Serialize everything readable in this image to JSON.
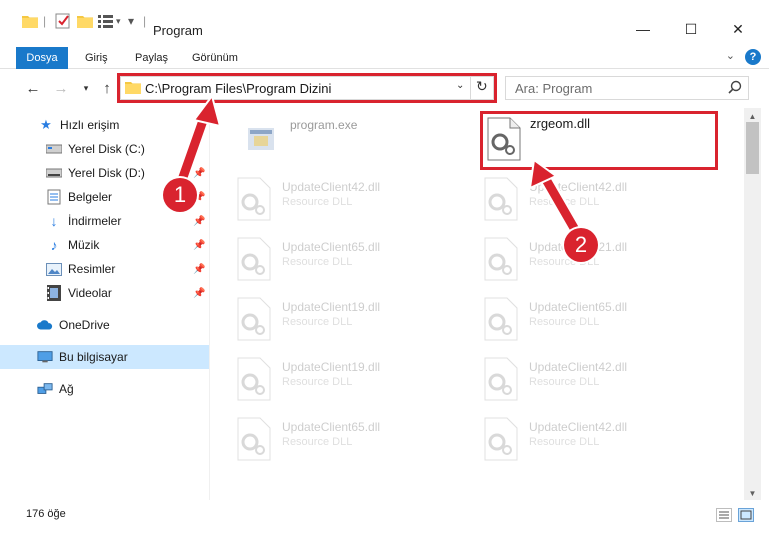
{
  "window": {
    "title": "Program",
    "minimize": "—",
    "maximize": "☐",
    "close": "✕"
  },
  "ribbon": {
    "file_tab": "Dosya",
    "tabs": [
      "Giriş",
      "Paylaş",
      "Görünüm"
    ],
    "help": "?",
    "collapse": "⌄"
  },
  "nav": {
    "address": "C:\\Program Files\\Program Dizini",
    "search_placeholder": "Ara: Program"
  },
  "sidebar": {
    "items": [
      {
        "label": "Hızlı erişim",
        "icon": "star-icon"
      },
      {
        "label": "Yerel Disk (C:)",
        "icon": "disk-icon"
      },
      {
        "label": "Yerel Disk (D:)",
        "icon": "disk-icon"
      },
      {
        "label": "Belgeler",
        "icon": "documents-icon"
      },
      {
        "label": "İndirmeler",
        "icon": "download-icon"
      },
      {
        "label": "Müzik",
        "icon": "music-icon"
      },
      {
        "label": "Resimler",
        "icon": "pictures-icon"
      },
      {
        "label": "Videolar",
        "icon": "video-icon"
      },
      {
        "label": "OneDrive",
        "icon": "cloud-icon"
      },
      {
        "label": "Bu bilgisayar",
        "icon": "computer-icon"
      },
      {
        "label": "Ağ",
        "icon": "network-icon"
      }
    ]
  },
  "files": {
    "left": [
      {
        "name": "program.exe",
        "type": ""
      },
      {
        "name": "UpdateClient42.dll",
        "type": "Resource DLL"
      },
      {
        "name": "UpdateClient65.dll",
        "type": "Resource DLL"
      },
      {
        "name": "UpdateClient19.dll",
        "type": "Resource DLL"
      },
      {
        "name": "UpdateClient19.dll",
        "type": "Resource DLL"
      },
      {
        "name": "UpdateClient65.dll",
        "type": "Resource DLL"
      }
    ],
    "right": [
      {
        "name": "zrgeom.dll",
        "type": ""
      },
      {
        "name": "UpdateClient42.dll",
        "type": "Resource DLL"
      },
      {
        "name": "UpdateClient21.dll",
        "type": "Resource DLL"
      },
      {
        "name": "UpdateClient65.dll",
        "type": "Resource DLL"
      },
      {
        "name": "UpdateClient42.dll",
        "type": "Resource DLL"
      },
      {
        "name": "UpdateClient42.dll",
        "type": "Resource DLL"
      }
    ]
  },
  "status": {
    "count": "176 öğe"
  },
  "annotations": {
    "badge1": "1",
    "badge2": "2",
    "color": "#d9232e"
  }
}
